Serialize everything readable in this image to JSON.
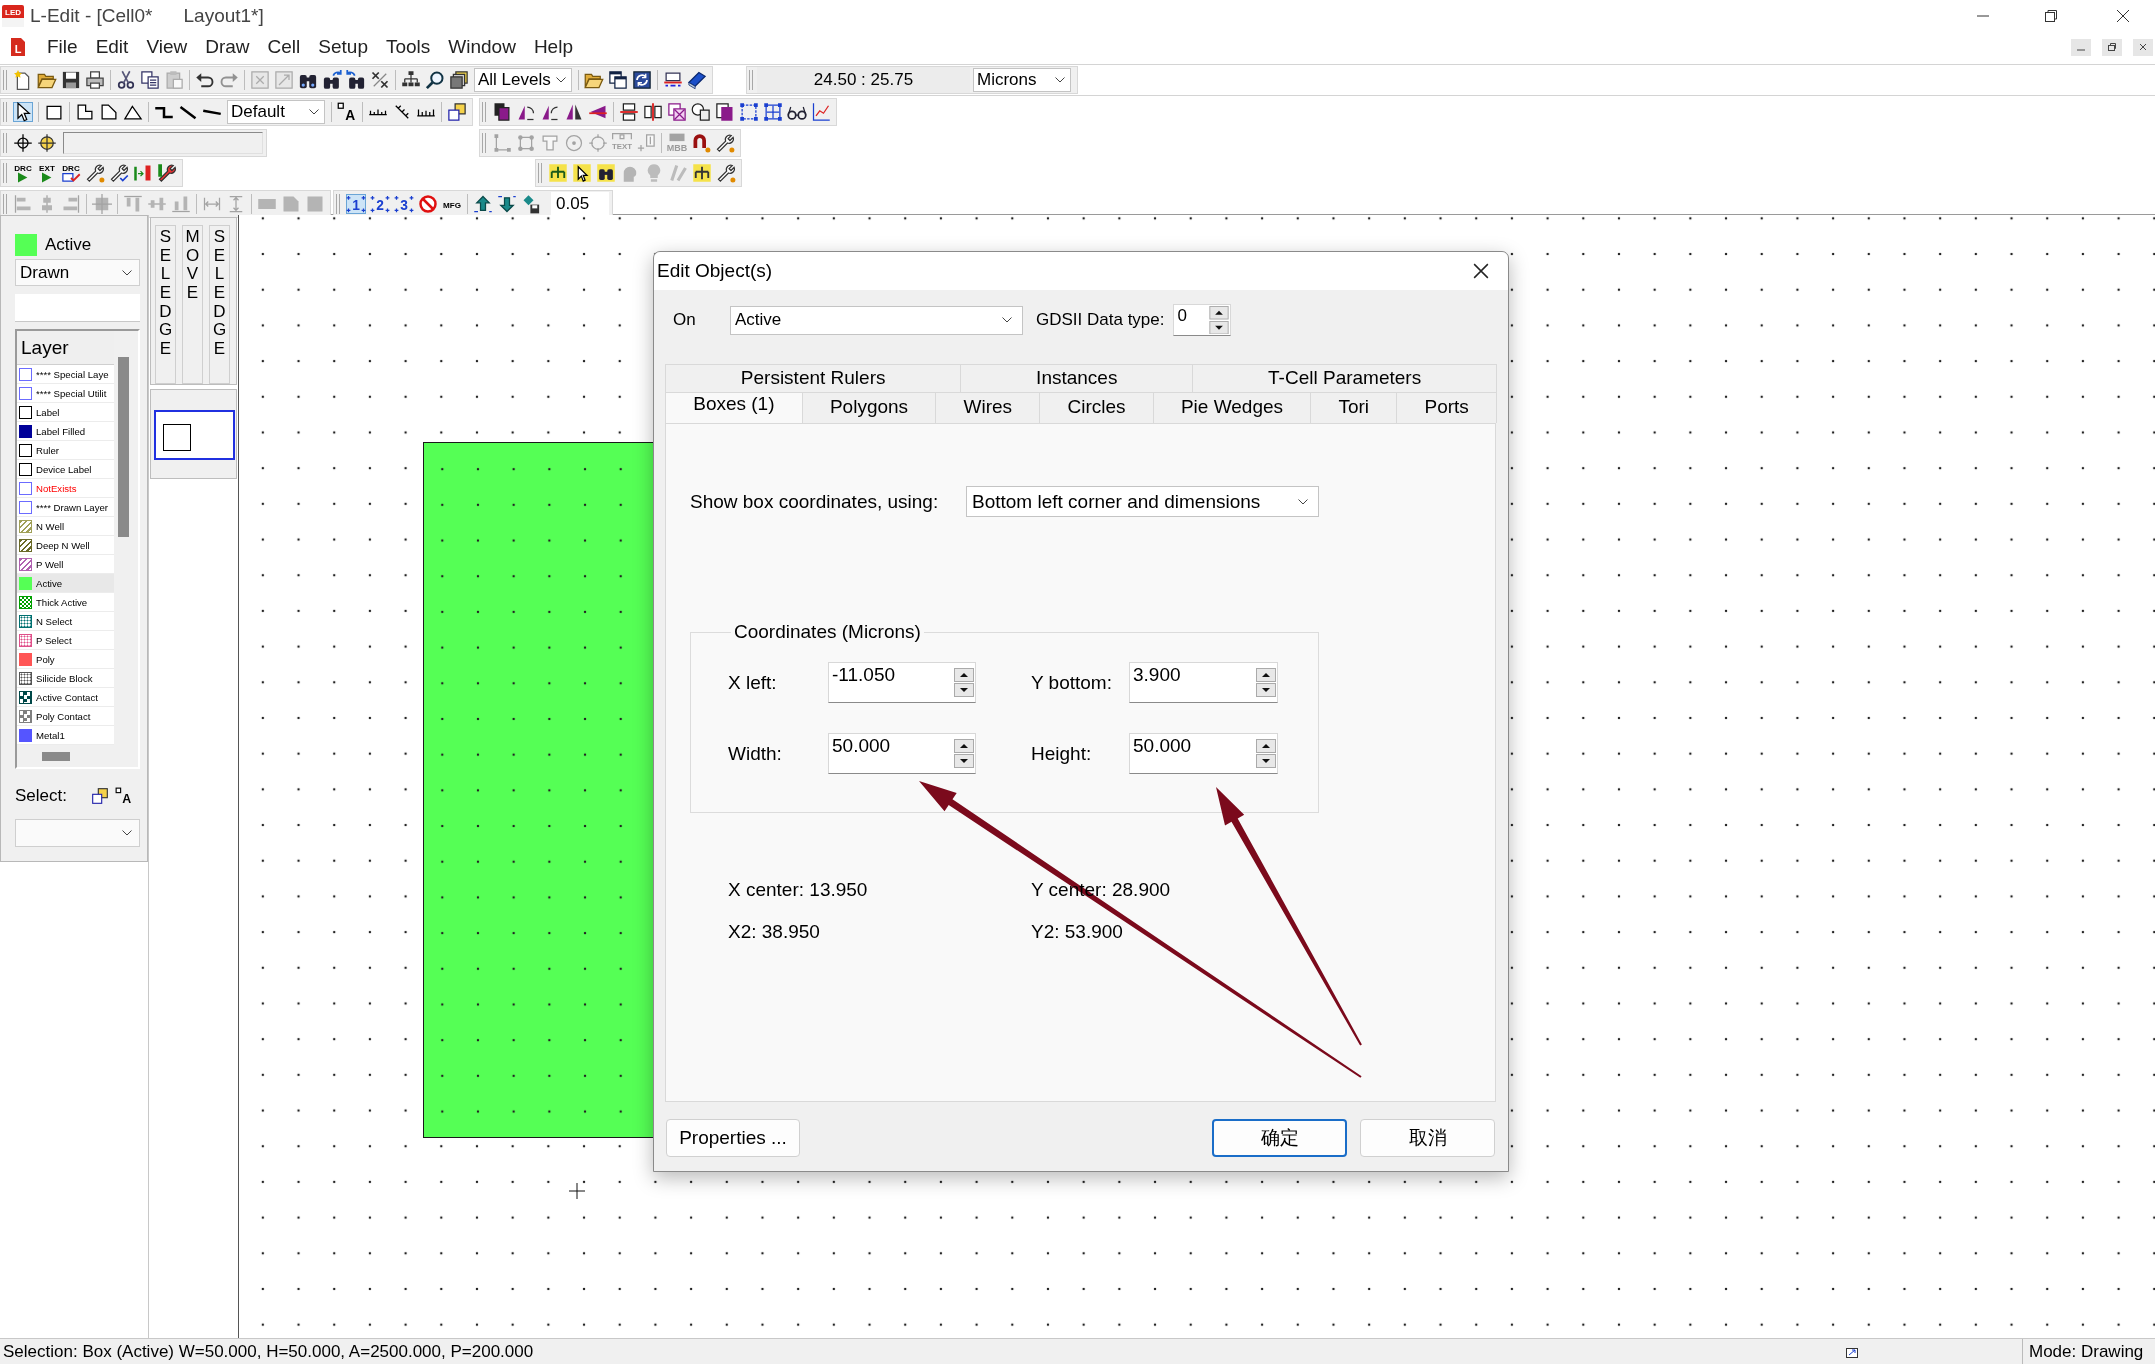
{
  "window": {
    "logo": "LED",
    "title_parts": [
      "L-Edit - [Cell0*",
      "Layout1*]"
    ]
  },
  "menu_bar": {
    "logo": "L",
    "items": [
      "File",
      "Edit",
      "View",
      "Draw",
      "Cell",
      "Setup",
      "Tools",
      "Window",
      "Help"
    ]
  },
  "toolbars": [
    {
      "segments": [
        {
          "items": [
            {
              "kind": "button",
              "disabled": false
            },
            {
              "kind": "button",
              "disabled": false
            },
            {
              "kind": "button",
              "disabled": false
            },
            {
              "kind": "button",
              "disabled": false
            },
            {
              "kind": "button",
              "disabled": false
            },
            {
              "kind": "button",
              "disabled": false
            },
            {
              "kind": "button",
              "disabled": true
            },
            {
              "kind": "button",
              "disabled": false
            },
            {
              "kind": "button",
              "disabled": true
            },
            {
              "kind": "button",
              "disabled": true
            },
            {
              "kind": "button",
              "disabled": true
            },
            {
              "kind": "button",
              "disabled": false
            },
            {
              "kind": "button",
              "disabled": false
            },
            {
              "kind": "button",
              "disabled": false
            },
            {
              "kind": "button",
              "disabled": false
            },
            {
              "kind": "button",
              "disabled": false
            },
            {
              "kind": "button",
              "disabled": false
            },
            {
              "kind": "button",
              "disabled": false
            },
            {
              "kind": "dropdown",
              "value": "All Levels"
            },
            {
              "kind": "button",
              "disabled": false
            },
            {
              "kind": "button",
              "disabled": false
            },
            {
              "kind": "button",
              "disabled": false
            },
            {
              "kind": "button",
              "disabled": false
            },
            {
              "kind": "button",
              "disabled": false
            }
          ]
        },
        {
          "items": [
            {
              "kind": "readout",
              "value": "24.50 : 25.75"
            },
            {
              "kind": "dropdown",
              "value": "Microns"
            }
          ]
        }
      ]
    },
    {
      "segments": [
        {
          "items": [
            {
              "kind": "button",
              "disabled": false,
              "selected": true
            },
            {
              "kind": "button",
              "disabled": false,
              "selected": false
            },
            {
              "kind": "button",
              "disabled": false,
              "selected": false
            },
            {
              "kind": "button",
              "disabled": false,
              "selected": false
            },
            {
              "kind": "button",
              "disabled": false,
              "selected": false
            },
            {
              "kind": "button",
              "disabled": false,
              "selected": false
            },
            {
              "kind": "button",
              "disabled": false,
              "selected": false
            },
            {
              "kind": "button",
              "disabled": false,
              "selected": false
            },
            {
              "kind": "dropdown",
              "value": "Default"
            },
            {
              "kind": "button",
              "disabled": false,
              "label": "A"
            },
            {
              "kind": "button",
              "disabled": false
            },
            {
              "kind": "button",
              "disabled": false
            },
            {
              "kind": "button",
              "disabled": false
            },
            {
              "kind": "button",
              "disabled": false
            }
          ]
        },
        {
          "items": [
            {
              "kind": "button",
              "disabled": false
            },
            {
              "kind": "button",
              "disabled": false
            },
            {
              "kind": "button",
              "disabled": false
            },
            {
              "kind": "button",
              "disabled": false
            },
            {
              "kind": "button",
              "disabled": false
            },
            {
              "kind": "button",
              "disabled": false
            },
            {
              "kind": "button",
              "disabled": false
            },
            {
              "kind": "button",
              "disabled": false
            },
            {
              "kind": "button",
              "disabled": false
            },
            {
              "kind": "button",
              "disabled": false
            },
            {
              "kind": "button",
              "disabled": false
            },
            {
              "kind": "button",
              "disabled": false
            },
            {
              "kind": "button",
              "disabled": false
            },
            {
              "kind": "button",
              "disabled": false
            }
          ]
        }
      ]
    },
    {
      "segments": [
        {
          "items": [
            {
              "kind": "button",
              "disabled": false
            },
            {
              "kind": "button",
              "disabled": false
            },
            {
              "kind": "field"
            }
          ]
        },
        {
          "items": [
            {
              "kind": "button",
              "disabled": true
            },
            {
              "kind": "button",
              "disabled": true
            },
            {
              "kind": "button",
              "disabled": true
            },
            {
              "kind": "button",
              "disabled": true
            },
            {
              "kind": "button",
              "disabled": true
            },
            {
              "kind": "button",
              "disabled": true,
              "label": "TEXT"
            },
            {
              "kind": "button",
              "disabled": true
            },
            {
              "kind": "button",
              "disabled": true,
              "label": "MBB"
            },
            {
              "kind": "button",
              "disabled": false
            },
            {
              "kind": "button",
              "disabled": false
            }
          ]
        }
      ]
    },
    {
      "segments": [
        {
          "items": [
            {
              "kind": "button",
              "disabled": false,
              "label": "DRC"
            },
            {
              "kind": "button",
              "disabled": false,
              "label": "EXT"
            },
            {
              "kind": "button",
              "disabled": false,
              "label": "DRC"
            },
            {
              "kind": "button",
              "disabled": false
            },
            {
              "kind": "button",
              "disabled": false
            },
            {
              "kind": "button",
              "disabled": false
            },
            {
              "kind": "button",
              "disabled": false
            }
          ]
        },
        {
          "items": [
            {
              "kind": "button",
              "disabled": false
            },
            {
              "kind": "button",
              "disabled": false
            },
            {
              "kind": "button",
              "disabled": false
            },
            {
              "kind": "button",
              "disabled": true
            },
            {
              "kind": "button",
              "disabled": true
            },
            {
              "kind": "button",
              "disabled": true
            },
            {
              "kind": "button",
              "disabled": false
            },
            {
              "kind": "button",
              "disabled": false
            }
          ]
        }
      ]
    },
    {
      "segments": [
        {
          "items": [
            {
              "kind": "button",
              "disabled": true
            },
            {
              "kind": "button",
              "disabled": true
            },
            {
              "kind": "button",
              "disabled": true
            },
            {
              "kind": "button",
              "disabled": true
            },
            {
              "kind": "button",
              "disabled": true
            },
            {
              "kind": "button",
              "disabled": true
            },
            {
              "kind": "button",
              "disabled": true
            },
            {
              "kind": "button",
              "disabled": true
            },
            {
              "kind": "button",
              "disabled": true
            },
            {
              "kind": "button",
              "disabled": true
            },
            {
              "kind": "button",
              "disabled": true
            },
            {
              "kind": "button",
              "disabled": true
            }
          ]
        },
        {
          "items": [
            {
              "kind": "button",
              "disabled": false,
              "selected": true,
              "label": "1"
            },
            {
              "kind": "button",
              "disabled": false,
              "selected": false,
              "label": "2"
            },
            {
              "kind": "button",
              "disabled": false,
              "selected": false,
              "label": "3"
            },
            {
              "kind": "button",
              "disabled": false
            },
            {
              "kind": "button",
              "disabled": false,
              "label": "MFG"
            },
            {
              "kind": "button",
              "disabled": false
            },
            {
              "kind": "button",
              "disabled": false
            },
            {
              "kind": "button",
              "disabled": false
            },
            {
              "kind": "field",
              "value": "0.05"
            }
          ]
        }
      ]
    }
  ],
  "layer_panel": {
    "current_layer": {
      "name": "Active",
      "color": "#55ff55"
    },
    "view_dropdown": "Drawn",
    "header": "Layer",
    "layers": [
      {
        "name": "**** Special Laye",
        "kind": "outline",
        "color": "#6b6bff",
        "selected": false,
        "exists": true
      },
      {
        "name": "**** Special Utilit",
        "kind": "outline",
        "color": "#6b6bff",
        "selected": false,
        "exists": true
      },
      {
        "name": "Label",
        "kind": "outline",
        "color": "#000000",
        "selected": false,
        "exists": true
      },
      {
        "name": "Label Filled",
        "kind": "solid",
        "color": "#000099",
        "selected": false,
        "exists": true
      },
      {
        "name": "Ruler",
        "kind": "outline",
        "color": "#000000",
        "selected": false,
        "exists": true
      },
      {
        "name": "Device Label",
        "kind": "outline",
        "color": "#000000",
        "selected": false,
        "exists": true
      },
      {
        "name": "NotExists",
        "kind": "outline",
        "color": "#6b6bff",
        "selected": false,
        "exists": false
      },
      {
        "name": "**** Drawn Layer",
        "kind": "outline",
        "color": "#6b6bff",
        "selected": false,
        "exists": true
      },
      {
        "name": "N Well",
        "kind": "hatch",
        "color": "#a0a058",
        "selected": false,
        "exists": true
      },
      {
        "name": "Deep N Well",
        "kind": "hatch",
        "color": "#6a6a28",
        "selected": false,
        "exists": true
      },
      {
        "name": "P Well",
        "kind": "hatch",
        "color": "#b060b0",
        "selected": false,
        "exists": true
      },
      {
        "name": "Active",
        "kind": "solid",
        "color": "#55ff55",
        "selected": true,
        "exists": true
      },
      {
        "name": "Thick Active",
        "kind": "checker",
        "color": "#00a000",
        "selected": false,
        "exists": true
      },
      {
        "name": "N Select",
        "kind": "dots",
        "color": "#007070",
        "selected": false,
        "exists": true
      },
      {
        "name": "P Select",
        "kind": "dots",
        "color": "#e0508a",
        "selected": false,
        "exists": true
      },
      {
        "name": "Poly",
        "kind": "solid",
        "color": "#ff5555",
        "selected": false,
        "exists": true
      },
      {
        "name": "Silicide Block",
        "kind": "dots",
        "color": "#555555",
        "selected": false,
        "exists": true
      },
      {
        "name": "Active Contact",
        "kind": "contact",
        "color": "#004848",
        "selected": false,
        "exists": true
      },
      {
        "name": "Poly Contact",
        "kind": "contact",
        "color": "#808080",
        "selected": false,
        "exists": true
      },
      {
        "name": "Metal1",
        "kind": "solid",
        "color": "#5555ff",
        "selected": false,
        "exists": true
      }
    ],
    "select_label": "Select:",
    "select_icon_label": "A"
  },
  "edge_buttons": [
    "SEL EDGE",
    "MOVE",
    "SEL EDGE"
  ],
  "dialog": {
    "title": "Edit Object(s)",
    "on_label": "On",
    "layer_dropdown": "Active",
    "datatype_label": "GDSII Data type:",
    "datatype_value": "0",
    "tab_rows": [
      [
        {
          "label": "Persistent Rulers",
          "selected": false
        },
        {
          "label": "Instances",
          "selected": false
        },
        {
          "label": "T-Cell Parameters",
          "selected": false
        }
      ],
      [
        {
          "label": "Boxes (1)",
          "selected": true
        },
        {
          "label": "Polygons",
          "selected": false
        },
        {
          "label": "Wires",
          "selected": false
        },
        {
          "label": "Circles",
          "selected": false
        },
        {
          "label": "Pie Wedges",
          "selected": false
        },
        {
          "label": "Tori",
          "selected": false
        },
        {
          "label": "Ports",
          "selected": false
        }
      ]
    ],
    "show_label": "Show box coordinates, using:",
    "show_dropdown": "Bottom left corner and dimensions",
    "group_title": "Coordinates (Microns)",
    "fields": [
      {
        "label": "X left:",
        "value": "-11.050"
      },
      {
        "label": "Y bottom:",
        "value": "3.900"
      },
      {
        "label": "Width:",
        "value": "50.000"
      },
      {
        "label": "Height:",
        "value": "50.000"
      }
    ],
    "readouts": [
      "X center: 13.950",
      "Y center: 28.900",
      "X2: 38.950",
      "Y2: 53.900"
    ],
    "buttons": [
      {
        "label": "Properties ...",
        "default": false
      },
      {
        "label": "确定",
        "default": true
      },
      {
        "label": "取消",
        "default": false
      }
    ]
  },
  "status_bar": {
    "selection": "Selection: Box (Active) W=50.000, H=50.000, A=2500.000, P=200.000",
    "mode": "Mode: Drawing"
  }
}
